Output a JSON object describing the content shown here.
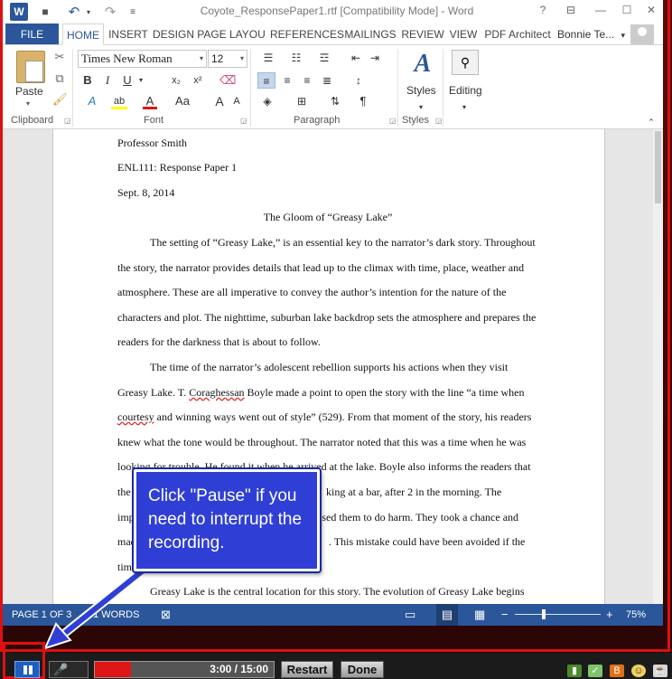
{
  "window": {
    "title": "Coyote_ResponsePaper1.rtf [Compatibility Mode] - Word",
    "help": "?",
    "ribbon_display": "⊟",
    "minimize": "—",
    "maximize": "☐",
    "close": "✕"
  },
  "qat": {
    "word_logo": "W",
    "save": "■",
    "undo": "↶",
    "undo_dd": "▾",
    "redo": "↷",
    "more": "≡"
  },
  "tabs": [
    "FILE",
    "HOME",
    "INSERT",
    "DESIGN",
    "PAGE LAYOU",
    "REFERENCES",
    "MAILINGS",
    "REVIEW",
    "VIEW",
    "PDF Architect"
  ],
  "user": "Bonnie Te...",
  "user_dd": "▾",
  "ribbon": {
    "clipboard": {
      "paste": "Paste",
      "label": "Clipboard"
    },
    "font": {
      "name": "Times New Roman",
      "size": "12",
      "label": "Font",
      "bold": "B",
      "italic": "I",
      "underline": "U",
      "sub": "x₂",
      "sup": "x²",
      "clear": "⌫",
      "effects": "A",
      "highlight": "ab",
      "color": "A",
      "case": "Aa",
      "grow": "A",
      "shrink": "A"
    },
    "paragraph": {
      "label": "Paragraph",
      "pilcrow": "¶"
    },
    "styles": {
      "icon": "A",
      "label": "Styles",
      "group_label": "Styles"
    },
    "editing": {
      "label": "Editing"
    }
  },
  "document": {
    "lines": [
      "Professor Smith",
      "ENL111: Response Paper 1",
      "Sept. 8, 2014",
      "The Gloom of “Greasy Lake”",
      "The setting of “Greasy Lake,” is an essential key to the narrator’s dark story. Throughout",
      "the story, the narrator provides details that lead up to the climax with time, place, weather and",
      "atmosphere. These are all imperative to convey the author’s intention for the nature of the",
      "characters and plot. The nighttime, suburban lake backdrop sets the atmosphere and prepares the",
      "readers for the darkness that is about to follow.",
      "The time of the narrator’s adolescent rebellion supports his actions when they visit",
      "Greasy Lake. T. ",
      "Coraghessan",
      " Boyle made a point to open the story with the line “a time when",
      "courtesy",
      " and winning ways went out of style” (529). From that moment of the story, his readers",
      "knew what the tone would be throughout. The narrator noted that this was a time when he was",
      "looking for trouble. He found it when he arrived at the lake. Boyle also informs the readers that",
      "the s",
      "king at a bar, after 2 in the morning. The",
      "imp",
      "ased them to do harm. They took a chance and",
      "mad",
      ". This mistake could have been avoided if the",
      "tim",
      "Greasy Lake is the central location for this story. The evolution of Greasy Lake begins"
    ]
  },
  "status": {
    "page": "PAGE 1 OF 3",
    "words": "41 WORDS",
    "proof": "⊠",
    "minus": "−",
    "plus": "+",
    "zoom": "75%",
    "zoom_level": 0.34
  },
  "callout": {
    "text": "Click \"Pause\" if you need to interrupt the recording."
  },
  "recorder": {
    "time": "3:00 / 15:00",
    "progress": 0.2,
    "restart": "Restart",
    "done": "Done",
    "mic": "🎤"
  },
  "colors": {
    "word_blue": "#2b579a",
    "record_red": "#e01515",
    "callout_blue": "#2f3fd6"
  }
}
